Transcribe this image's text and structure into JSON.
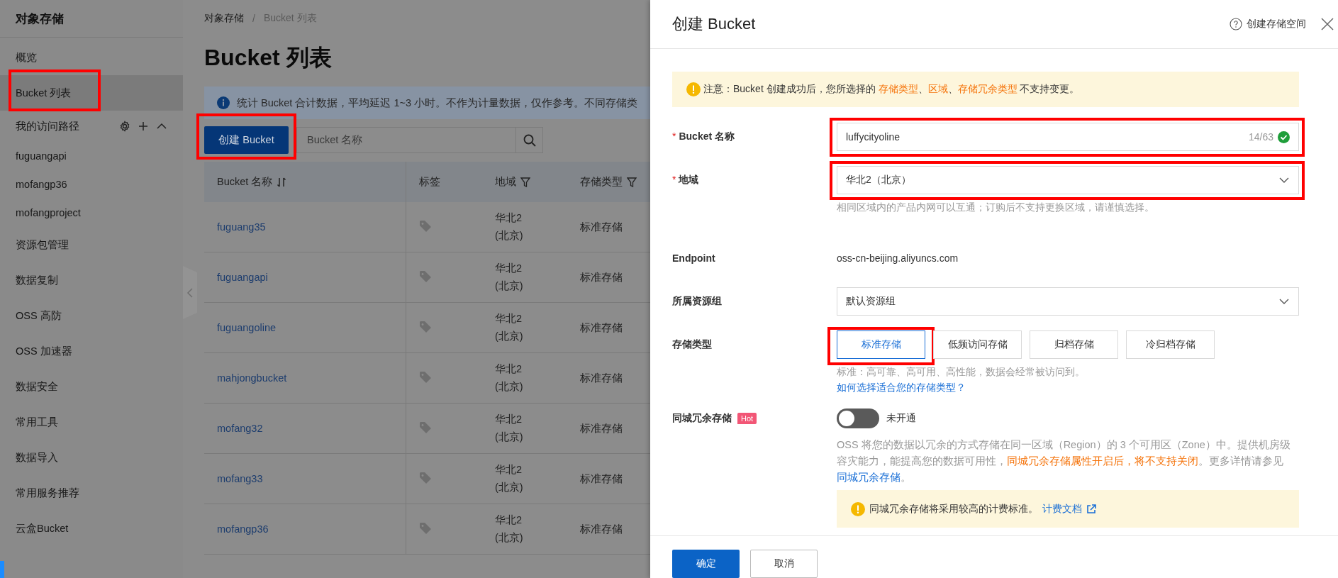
{
  "sidebar": {
    "title": "对象存储",
    "items": [
      {
        "kind": "link",
        "label": "概览",
        "selected": false,
        "highlighted": false
      },
      {
        "kind": "link",
        "label": "Bucket 列表",
        "selected": true,
        "highlighted": true
      },
      {
        "kind": "group",
        "label": "我的访问路径",
        "selected": false,
        "highlighted": false
      },
      {
        "kind": "path",
        "label": "fuguangapi",
        "selected": false,
        "highlighted": false
      },
      {
        "kind": "path",
        "label": "mofangp36",
        "selected": false,
        "highlighted": false
      },
      {
        "kind": "path",
        "label": "mofangproject",
        "selected": false,
        "highlighted": false
      },
      {
        "kind": "link",
        "label": "资源包管理",
        "selected": false,
        "highlighted": false
      },
      {
        "kind": "link",
        "label": "数据复制",
        "selected": false,
        "highlighted": false
      },
      {
        "kind": "link",
        "label": "OSS 高防",
        "selected": false,
        "highlighted": false
      },
      {
        "kind": "link",
        "label": "OSS 加速器",
        "selected": false,
        "highlighted": false
      },
      {
        "kind": "link",
        "label": "数据安全",
        "selected": false,
        "highlighted": false
      },
      {
        "kind": "link",
        "label": "常用工具",
        "selected": false,
        "highlighted": false
      },
      {
        "kind": "link",
        "label": "数据导入",
        "selected": false,
        "highlighted": false
      },
      {
        "kind": "link",
        "label": "常用服务推荐",
        "selected": false,
        "highlighted": false
      },
      {
        "kind": "link",
        "label": "云盒Bucket",
        "selected": false,
        "highlighted": false
      }
    ]
  },
  "main": {
    "breadcrumb": [
      "对象存储",
      "Bucket 列表"
    ],
    "breadcrumb_separator": "/",
    "title": "Bucket 列表",
    "info": "统计 Bucket 合计数据，平均延迟 1~3 小时。不作为计量数据，仅作参考。不同存储类",
    "create_button": {
      "label": "创建 Bucket",
      "highlighted": true
    },
    "search": {
      "placeholder": "Bucket 名称"
    },
    "table": {
      "columns": [
        {
          "label": "Bucket 名称",
          "kind": "sort"
        },
        {
          "label": "标签",
          "kind": "plain"
        },
        {
          "label": "地域",
          "kind": "filter"
        },
        {
          "label": "存储类型",
          "kind": "filter"
        }
      ],
      "rows": [
        {
          "name": "fuguang35",
          "region": "华北2 (北京)",
          "storage_type": "标准存储"
        },
        {
          "name": "fuguangapi",
          "region": "华北2 (北京)",
          "storage_type": "标准存储"
        },
        {
          "name": "fuguangoline",
          "region": "华北2 (北京)",
          "storage_type": "标准存储"
        },
        {
          "name": "mahjongbucket",
          "region": "华北2 (北京)",
          "storage_type": "标准存储"
        },
        {
          "name": "mofang32",
          "region": "华北2 (北京)",
          "storage_type": "标准存储"
        },
        {
          "name": "mofang33",
          "region": "华北2 (北京)",
          "storage_type": "标准存储"
        },
        {
          "name": "mofangp36",
          "region": "华北2 (北京)",
          "storage_type": "标准存储"
        }
      ]
    }
  },
  "drawer": {
    "title": "创建 Bucket",
    "help": "创建存储空间",
    "required_mark": "*",
    "notice": [
      {
        "kind": "text",
        "text": "注意：Bucket 创建成功后，您所选择的 "
      },
      {
        "kind": "emphasis",
        "text": "存储类型"
      },
      {
        "kind": "text",
        "text": "、"
      },
      {
        "kind": "emphasis",
        "text": "区域"
      },
      {
        "kind": "text",
        "text": "、"
      },
      {
        "kind": "emphasis",
        "text": "存储冗余类型"
      },
      {
        "kind": "text",
        "text": " 不支持变更。"
      }
    ],
    "fields": [
      {
        "kind": "input",
        "label": "Bucket 名称",
        "required": true,
        "highlighted": true,
        "value": "luffycityoline",
        "counter": "14/63",
        "valid": true
      },
      {
        "kind": "select",
        "label": "地域",
        "required": true,
        "highlighted": true,
        "value": "华北2（北京）",
        "hint": "相同区域内的产品内网可以互通；订购后不支持更换区域，请谨慎选择。"
      },
      {
        "kind": "static",
        "label": "Endpoint",
        "required": false,
        "highlighted": false,
        "value": "oss-cn-beijing.aliyuncs.com"
      },
      {
        "kind": "select",
        "label": "所属资源组",
        "required": false,
        "highlighted": false,
        "value": "默认资源组"
      },
      {
        "kind": "options",
        "label": "存储类型",
        "required": false,
        "highlighted": false,
        "options": [
          {
            "label": "标准存储",
            "selected": true,
            "highlighted": true
          },
          {
            "label": "低频访问存储",
            "selected": false,
            "highlighted": false
          },
          {
            "label": "归档存储",
            "selected": false,
            "highlighted": false
          },
          {
            "label": "冷归档存储",
            "selected": false,
            "highlighted": false
          }
        ],
        "hint": "标准：高可靠、高可用、高性能，数据会经常被访问到。",
        "link": "如何选择适合您的存储类型？"
      },
      {
        "kind": "toggle",
        "label": "同城冗余存储",
        "required": false,
        "highlighted": false,
        "badge": "Hot",
        "on": false,
        "status": "未开通",
        "description": [
          {
            "kind": "text",
            "text": "OSS 将您的数据以冗余的方式存储在同一区域（Region）的 3 个可用区（Zone）中。提供机房级容灾能力，能提高您的数据可用性，"
          },
          {
            "kind": "emphasis",
            "text": "同城冗余存储属性开启后，将不支持关闭"
          },
          {
            "kind": "text",
            "text": "。更多详情请参见 "
          },
          {
            "kind": "link",
            "text": "同城冗余存储"
          },
          {
            "kind": "text",
            "text": "。"
          }
        ],
        "note": {
          "text": "同城冗余存储将采用较高的计费标准。",
          "link": "计费文档"
        }
      }
    ],
    "buttons": [
      {
        "label": "确定",
        "kind": "primary"
      },
      {
        "label": "取消",
        "kind": "default"
      }
    ]
  }
}
